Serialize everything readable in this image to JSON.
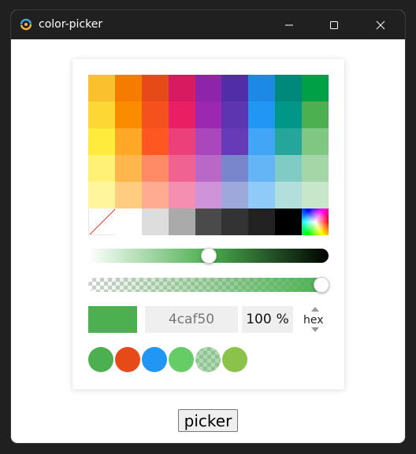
{
  "window": {
    "title": "color-picker"
  },
  "palette": {
    "rows": [
      [
        "#fbc02d",
        "#f57c00",
        "#e64a19",
        "#d81b60",
        "#8e24aa",
        "#512da8",
        "#1e88e5",
        "#00897b",
        "#00a046"
      ],
      [
        "#fdd835",
        "#fb8c00",
        "#f4511e",
        "#e91e63",
        "#9c27b0",
        "#5e35b1",
        "#2196f3",
        "#009688",
        "#4caf50"
      ],
      [
        "#ffeb3b",
        "#ffa726",
        "#ff5722",
        "#ec407a",
        "#ab47bc",
        "#673ab7",
        "#42a5f5",
        "#26a69a",
        "#81c784"
      ],
      [
        "#fff176",
        "#ffb74d",
        "#ff8a65",
        "#f06292",
        "#ba68c8",
        "#7986cb",
        "#64b5f6",
        "#80cbc4",
        "#a5d6a7"
      ],
      [
        "#fff59d",
        "#ffcc80",
        "#ffab91",
        "#f48fb1",
        "#ce93d8",
        "#9fa8da",
        "#90caf9",
        "#b2dfdb",
        "#c8e6c9"
      ],
      [
        "none",
        "#ffffff",
        "#dddddd",
        "#aaaaaa",
        "#4a4a4a",
        "#333333",
        "#222222",
        "#000000",
        "rainbow"
      ]
    ]
  },
  "shade_slider": {
    "value": 0.5
  },
  "alpha_slider": {
    "value": 1.0
  },
  "current": {
    "color": "#4caf50"
  },
  "hex_input": {
    "value": "4caf50"
  },
  "alpha_input": {
    "value": "100",
    "unit": "%"
  },
  "mode_toggle": {
    "label": "hex"
  },
  "history": [
    "#4caf50",
    "#e64a19",
    "#2196f3",
    "#66cc66",
    "checker",
    "#8bc34a"
  ],
  "picker_button": {
    "label": "picker"
  }
}
